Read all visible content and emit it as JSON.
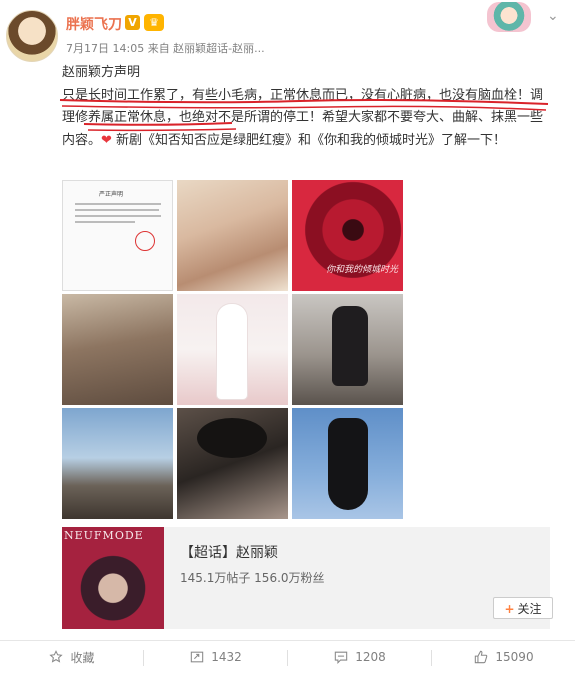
{
  "post": {
    "username": "胖颖飞刀",
    "verified_badge": "V",
    "member_badge": "♛",
    "meta": "7月17日 14:05 来自 赵丽颖超话-赵丽...",
    "text_parts": [
      "赵丽颖方声明",
      "只是长时间工作累了，有些小毛病，正常休息而已，没有心脏病，也没有脑血栓！调理修养属正常休息，也绝对不是所谓的停工！希望大家都不要夸大、曲解、抹黑一些内容。",
      "❤",
      " 新剧《知否知否应是绿肥红瘦》和《你和我的倾城时光》了解一下！"
    ],
    "annotation_color": "#d9232a"
  },
  "photos": {
    "doc_title": "严正声明",
    "rose_text": "你和我的倾城时光"
  },
  "card": {
    "brand": "NEUFMODE",
    "title": "【超话】赵丽颖",
    "stats": "145.1万帖子 156.0万粉丝",
    "follow_label": "关注",
    "follow_plus": "+"
  },
  "actions": {
    "favorite_label": "收藏",
    "repost_count": "1432",
    "comment_count": "1208",
    "like_count": "15090"
  },
  "icons": {
    "favorite": "star-icon",
    "repost": "repost-icon",
    "comment": "comment-icon",
    "like": "thumbs-up-icon",
    "more": "chevron-down-icon"
  }
}
